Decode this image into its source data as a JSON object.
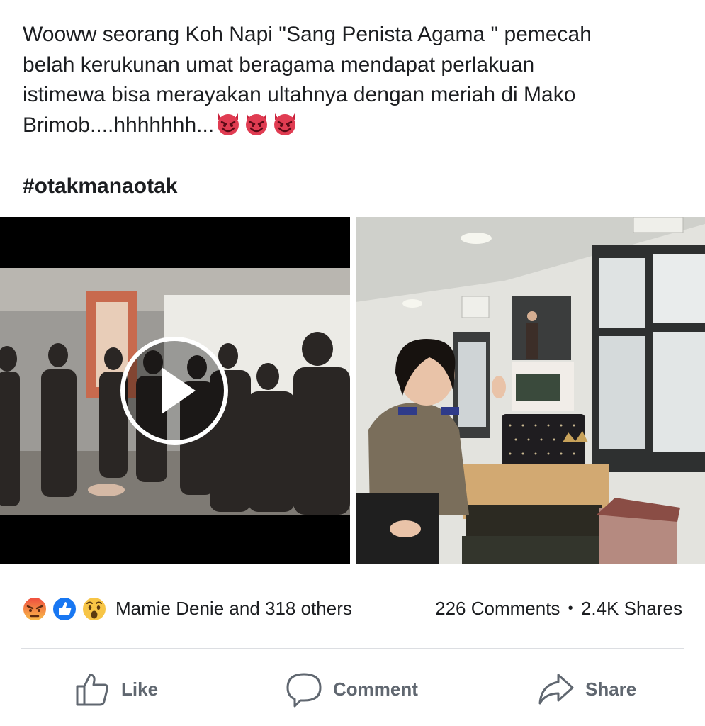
{
  "post": {
    "text_lines": [
      "Wooww seorang Koh Napi \"Sang Penista Agama \" pemecah",
      "belah kerukunan umat beragama mendapat perlakuan",
      "istimewa bisa merayakan ultahnya dengan meriah di Mako",
      "Brimob....hhhhhhh..."
    ],
    "emoji_icons": [
      "smiling-devil-icon",
      "smiling-devil-icon",
      "smiling-devil-icon"
    ],
    "hashtag": "#otakmanaotak"
  },
  "media": [
    {
      "kind": "video",
      "description_icon": "play-icon"
    },
    {
      "kind": "photo"
    }
  ],
  "reactions": {
    "icons": [
      "angry-icon",
      "like-icon",
      "wow-icon"
    ],
    "summary": "Mamie Denie and 318 others",
    "comments": "226 Comments",
    "separator": "•",
    "shares": "2.4K Shares"
  },
  "actions": {
    "like": "Like",
    "comment": "Comment",
    "share": "Share"
  },
  "colors": {
    "text": "#1c1e21",
    "muted": "#606770",
    "like_blue": "#1877f2",
    "angry_red": "#e9573f",
    "wow_yellow": "#f7c546"
  }
}
